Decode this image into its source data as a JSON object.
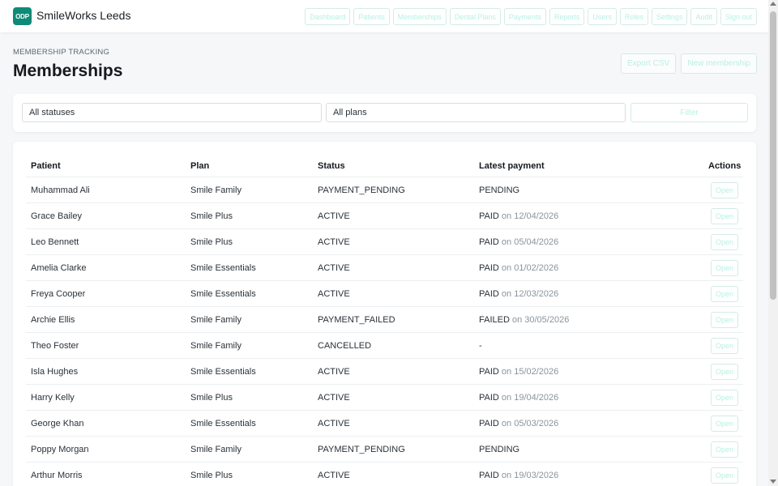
{
  "app": {
    "logo_text": "ODP",
    "brand": "SmileWorks Leeds",
    "nav": [
      "Dashboard",
      "Patients",
      "Memberships",
      "Dental Plans",
      "Payments",
      "Reports",
      "Users",
      "Roles",
      "Settings",
      "Audit",
      "Sign out"
    ]
  },
  "header": {
    "eyebrow": "MEMBERSHIP TRACKING",
    "title": "Memberships",
    "export_label": "Export CSV",
    "new_label": "New membership"
  },
  "filters": {
    "status_value": "All statuses",
    "plan_value": "All plans",
    "filter_label": "Filter"
  },
  "table": {
    "columns": [
      "Patient",
      "Plan",
      "Status",
      "Latest payment",
      "Actions"
    ],
    "action_label": "Open",
    "rows": [
      {
        "patient": "Muhammad Ali",
        "plan": "Smile Family",
        "status": "PAYMENT_PENDING",
        "payment": "PENDING",
        "date": ""
      },
      {
        "patient": "Grace Bailey",
        "plan": "Smile Plus",
        "status": "ACTIVE",
        "payment": "PAID",
        "date": "on 12/04/2026"
      },
      {
        "patient": "Leo Bennett",
        "plan": "Smile Plus",
        "status": "ACTIVE",
        "payment": "PAID",
        "date": "on 05/04/2026"
      },
      {
        "patient": "Amelia Clarke",
        "plan": "Smile Essentials",
        "status": "ACTIVE",
        "payment": "PAID",
        "date": "on 01/02/2026"
      },
      {
        "patient": "Freya Cooper",
        "plan": "Smile Essentials",
        "status": "ACTIVE",
        "payment": "PAID",
        "date": "on 12/03/2026"
      },
      {
        "patient": "Archie Ellis",
        "plan": "Smile Family",
        "status": "PAYMENT_FAILED",
        "payment": "FAILED",
        "date": "on 30/05/2026"
      },
      {
        "patient": "Theo Foster",
        "plan": "Smile Family",
        "status": "CANCELLED",
        "payment": "-",
        "date": ""
      },
      {
        "patient": "Isla Hughes",
        "plan": "Smile Essentials",
        "status": "ACTIVE",
        "payment": "PAID",
        "date": "on 15/02/2026"
      },
      {
        "patient": "Harry Kelly",
        "plan": "Smile Plus",
        "status": "ACTIVE",
        "payment": "PAID",
        "date": "on 19/04/2026"
      },
      {
        "patient": "George Khan",
        "plan": "Smile Essentials",
        "status": "ACTIVE",
        "payment": "PAID",
        "date": "on 05/03/2026"
      },
      {
        "patient": "Poppy Morgan",
        "plan": "Smile Family",
        "status": "PAYMENT_PENDING",
        "payment": "PENDING",
        "date": ""
      },
      {
        "patient": "Arthur Morris",
        "plan": "Smile Plus",
        "status": "ACTIVE",
        "payment": "PAID",
        "date": "on 19/03/2026"
      }
    ]
  },
  "colors": {
    "brand": "#0e8a77",
    "ghost_text": "#b8f0e3"
  }
}
